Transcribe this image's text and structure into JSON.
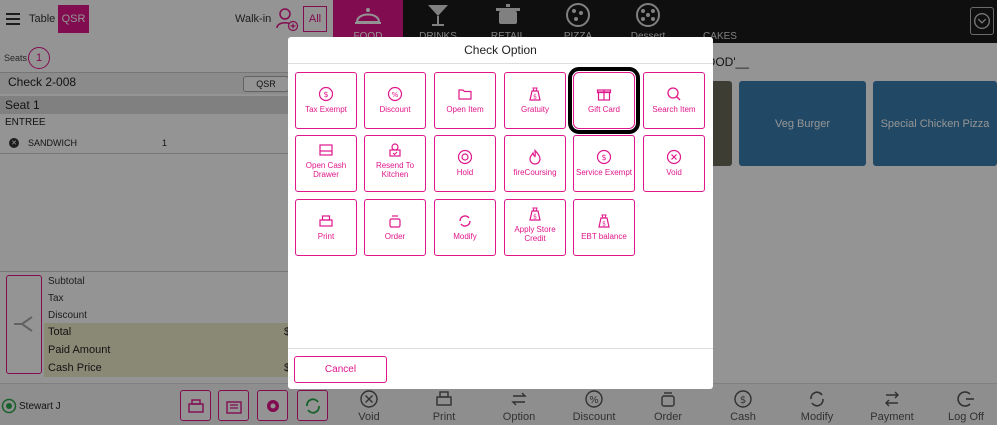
{
  "top": {
    "table_label": "Table",
    "qsr_label": "QSR",
    "walkin_label": "Walk-in",
    "all_label": "All",
    "categories": [
      {
        "label": "FOOD",
        "icon": "food-cloche-icon"
      },
      {
        "label": "DRINKS",
        "icon": "cocktail-icon"
      },
      {
        "label": "RETAIL",
        "icon": "pot-icon"
      },
      {
        "label": "PIZZA",
        "icon": "pizza-icon"
      },
      {
        "label": "Dessert",
        "icon": "dessert-icon"
      },
      {
        "label": "CAKES",
        "icon": ""
      }
    ]
  },
  "left": {
    "seats_label": "Seats",
    "seats_count": "1",
    "check_title": "Check 2-008",
    "check_mode": "QSR",
    "seat_title": "Seat 1",
    "course": "ENTREE",
    "items": [
      {
        "name": "SANDWICH",
        "qty": "1"
      }
    ],
    "totals": {
      "subtotal": "Subtotal",
      "tax": "Tax",
      "discount": "Discount",
      "total": "Total",
      "paid_amount": "Paid Amount",
      "cash_price": "Cash Price",
      "value_prefix": "$"
    }
  },
  "products": {
    "header": "OOD'__",
    "tiles": [
      "Veg Burger",
      "Special Chicken Pizza"
    ]
  },
  "bottom": {
    "user": "Stewart J",
    "actions": [
      "Void",
      "Print",
      "Option",
      "Discount",
      "Order",
      "Cash",
      "Modify",
      "Payment",
      "Log Off"
    ]
  },
  "modal": {
    "title": "Check Option",
    "options": [
      "Tax Exempt",
      "Discount",
      "Open Item",
      "Gratuity",
      "Gift Card",
      "Search Item",
      "Open Cash Drawer",
      "Resend To Kitchen",
      "Hold",
      "fireCoursing",
      "Service Exempt",
      "Void",
      "Print",
      "Order",
      "Modify",
      "Apply Store Credit",
      "EBT balance"
    ],
    "cancel": "Cancel",
    "selected": "Gift Card"
  },
  "colors": {
    "accent": "#e0168a",
    "tile": "#3a7fb0",
    "topbar": "#1b1b1b"
  }
}
